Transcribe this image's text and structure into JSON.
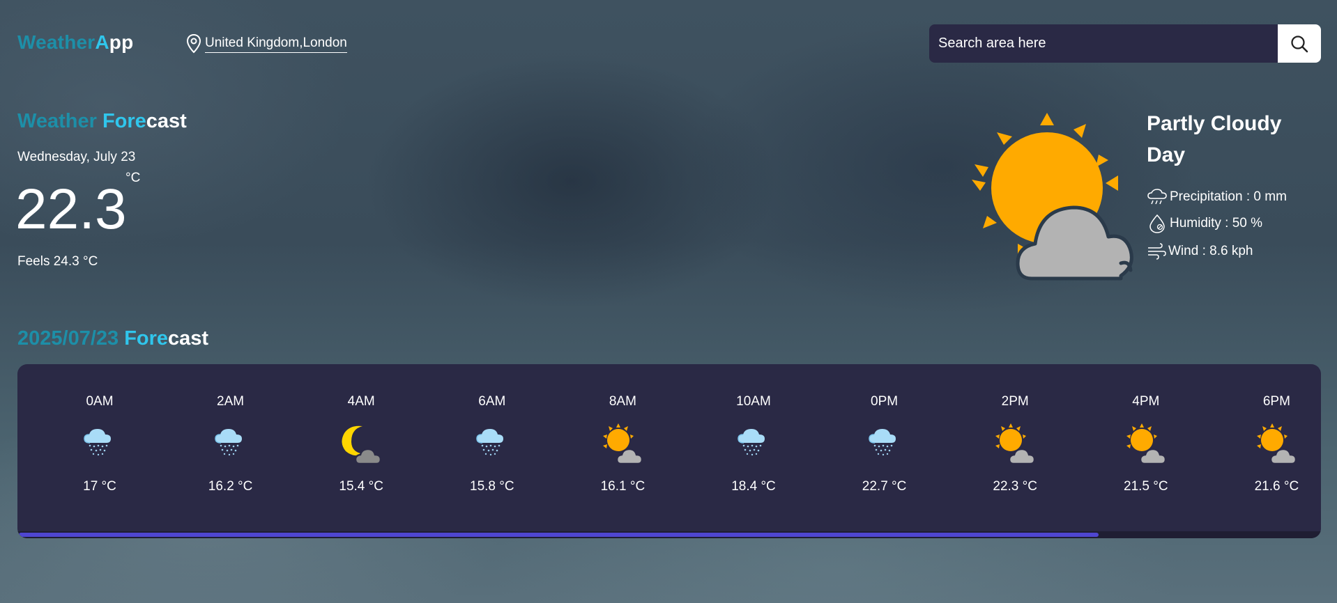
{
  "header": {
    "logo": {
      "part1": "Weather",
      "part2": "A",
      "part3": "pp"
    },
    "location": "United Kingdom,London",
    "search": {
      "placeholder": "Search area here",
      "value": ""
    }
  },
  "current": {
    "title": {
      "part1": "Weather ",
      "part2": "Fore",
      "part3": "cast"
    },
    "date": "Wednesday, July 23",
    "temperature": "22.3",
    "unit": "°C",
    "feels": "Feels 24.3 °C",
    "condition": "Partly Cloudy Day",
    "precipitation": "Precipitation : 0 mm",
    "humidity": "Humidity : 50 %",
    "wind": "Wind : 8.6 kph",
    "icon": "partly-cloudy-day-icon"
  },
  "forecast": {
    "title": {
      "part1": "2025/07/23 ",
      "part2": "Fore",
      "part3": "cast"
    },
    "hours": [
      {
        "time": "0AM",
        "temp": "17 °C",
        "icon": "rain-icon"
      },
      {
        "time": "2AM",
        "temp": "16.2 °C",
        "icon": "rain-icon"
      },
      {
        "time": "4AM",
        "temp": "15.4 °C",
        "icon": "partly-cloudy-night-icon"
      },
      {
        "time": "6AM",
        "temp": "15.8 °C",
        "icon": "rain-icon"
      },
      {
        "time": "8AM",
        "temp": "16.1 °C",
        "icon": "partly-cloudy-day-icon"
      },
      {
        "time": "10AM",
        "temp": "18.4 °C",
        "icon": "rain-icon"
      },
      {
        "time": "0PM",
        "temp": "22.7 °C",
        "icon": "rain-icon"
      },
      {
        "time": "2PM",
        "temp": "22.3 °C",
        "icon": "partly-cloudy-day-icon"
      },
      {
        "time": "4PM",
        "temp": "21.5 °C",
        "icon": "partly-cloudy-day-icon"
      },
      {
        "time": "6PM",
        "temp": "21.6 °C",
        "icon": "partly-cloudy-day-icon"
      }
    ],
    "scroll_position": 0.83
  },
  "colors": {
    "accent_dark": "#1d8fa8",
    "accent_light": "#30c6ec",
    "panel": "#2a2945",
    "sun": "#ffaa00",
    "cloud": "#b3b3b3",
    "scrollbar": "#4f46d1"
  }
}
